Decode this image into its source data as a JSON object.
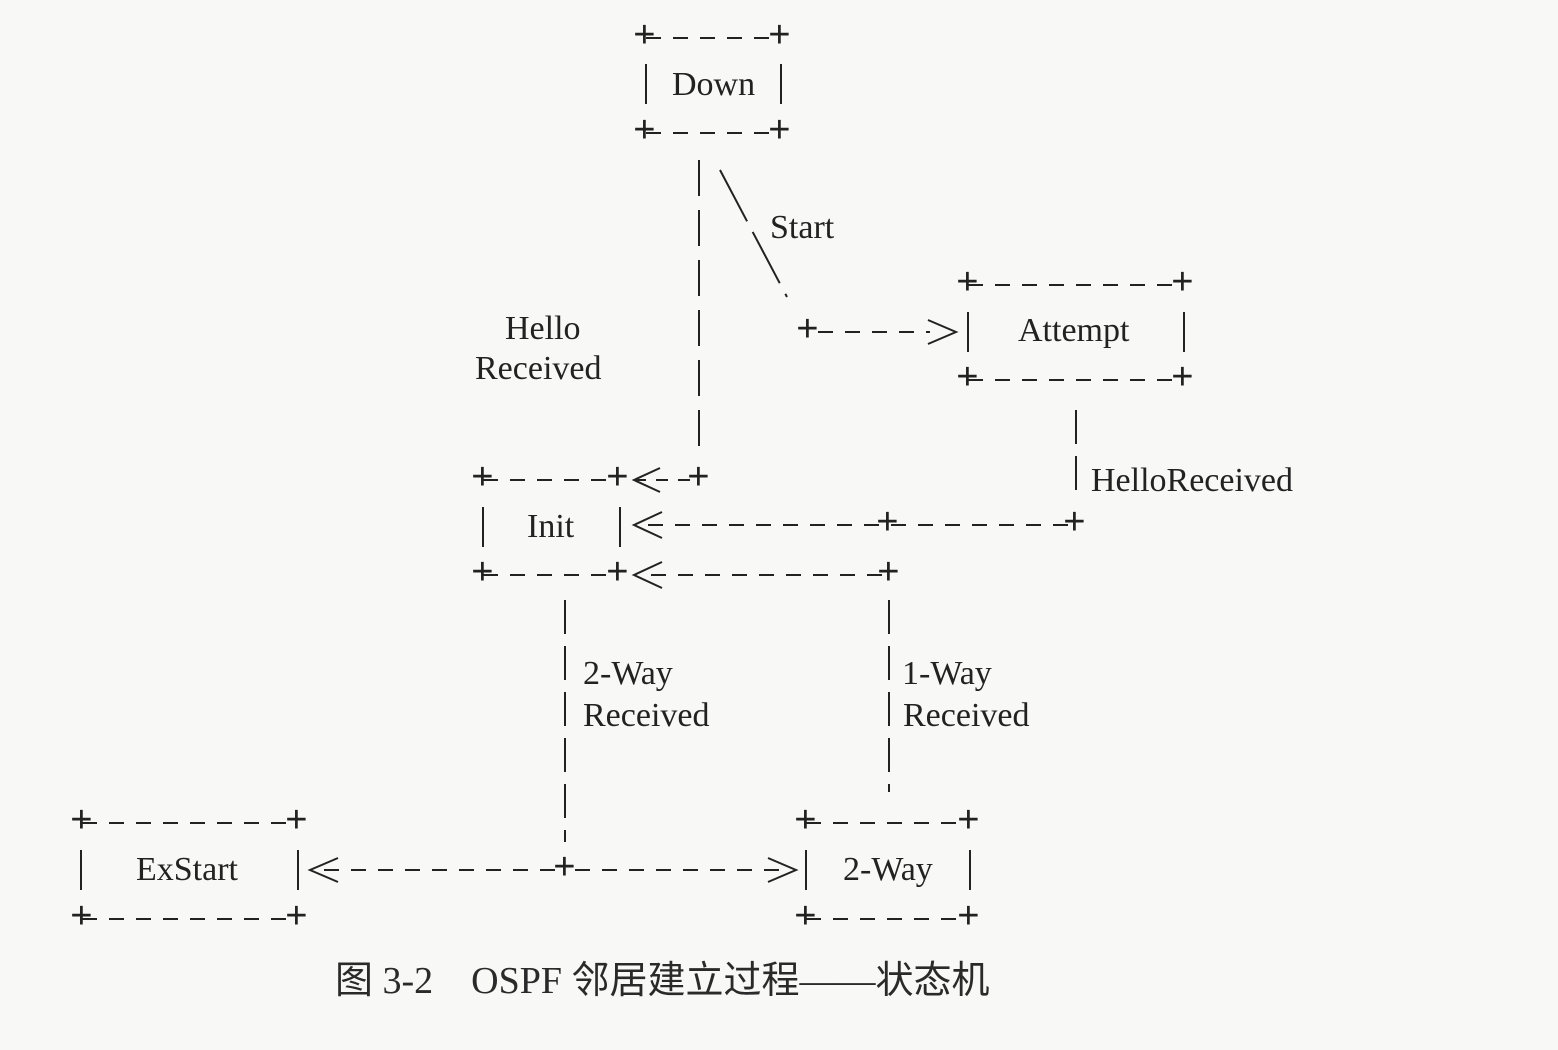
{
  "states": {
    "down": "Down",
    "attempt": "Attempt",
    "init": "Init",
    "exstart": "ExStart",
    "two_way": "2-Way"
  },
  "events": {
    "start": "Start",
    "hello_received_line1": "Hello",
    "hello_received_line2": "Received",
    "hello_received_attempt": "HelloReceived",
    "two_way_received_line1": "2-Way",
    "two_way_received_line2": "Received",
    "one_way_received_line1": "1-Way",
    "one_way_received_line2": "Received"
  },
  "caption": {
    "figure_number": "图 3-2",
    "title": "OSPF 邻居建立过程——状态机"
  },
  "colors": {
    "ink": "#222222",
    "paper": "#f8f8f6"
  }
}
